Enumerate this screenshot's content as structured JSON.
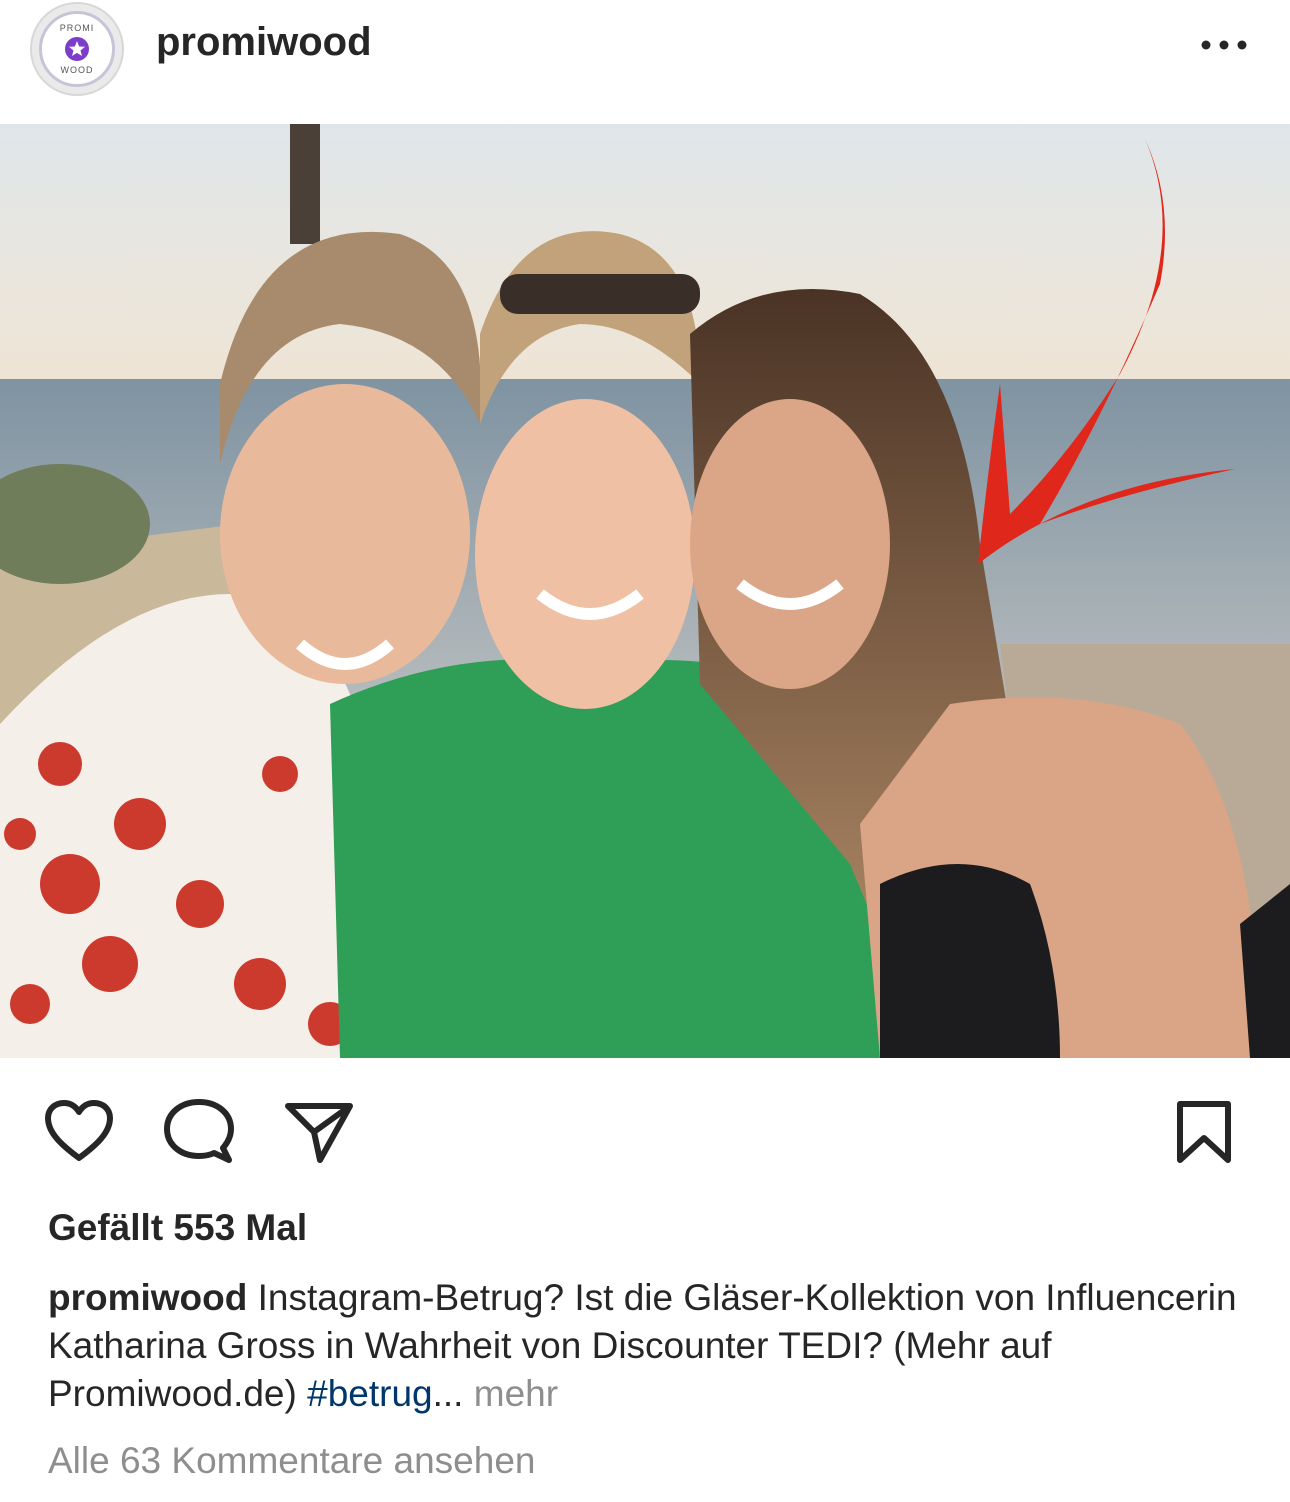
{
  "post": {
    "header": {
      "username": "promiwood",
      "avatar": {
        "top_text": "PROMI",
        "bottom_text": "WOOD"
      },
      "more_icon": "more-horizontal-icon"
    },
    "image": {
      "description_icon": "post-photo",
      "arrow_color": "#e0271b"
    },
    "actions": {
      "like_icon": "heart-icon",
      "comment_icon": "comment-icon",
      "share_icon": "send-icon",
      "save_icon": "bookmark-icon"
    },
    "likes": "Gefällt 553 Mal",
    "caption": {
      "username": "promiwood",
      "text": "Instagram-Betrug? Ist die Gläser-Kollektion von Influencerin Katharina Gross in Wahrheit von Discounter TEDI? (Mehr auf Promiwood.de)",
      "hashtag": "#betrug",
      "ellipsis": "...",
      "more": "mehr"
    },
    "comments_link": "Alle 63 Kommentare ansehen"
  },
  "colors": {
    "text": "#262626",
    "secondary": "#8e8e8e",
    "hashtag": "#00376b"
  }
}
